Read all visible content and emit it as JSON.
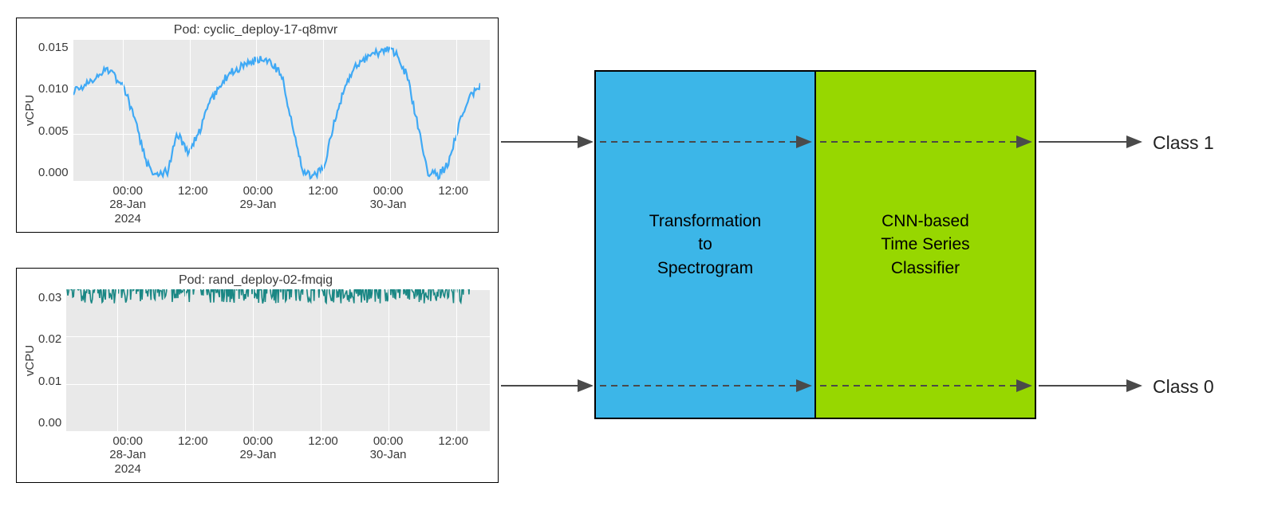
{
  "chart_data": [
    {
      "type": "line",
      "title": "Pod: cyclic_deploy-17-q8mvr",
      "ylabel": "vCPU",
      "xlabel": "",
      "ylim": [
        0.0,
        0.015
      ],
      "yticks": [
        "0.015",
        "0.010",
        "0.005",
        "0.000"
      ],
      "xticks": [
        {
          "pos": 0.12,
          "lines": [
            "00:00",
            "28-Jan",
            "2024"
          ]
        },
        {
          "pos": 0.28,
          "lines": [
            "12:00"
          ]
        },
        {
          "pos": 0.44,
          "lines": [
            "00:00",
            "29-Jan"
          ]
        },
        {
          "pos": 0.6,
          "lines": [
            "12:00"
          ]
        },
        {
          "pos": 0.76,
          "lines": [
            "00:00",
            "30-Jan"
          ]
        },
        {
          "pos": 0.92,
          "lines": [
            "12:00"
          ]
        }
      ],
      "series": [
        {
          "name": "vCPU",
          "color": "#3fa9f5",
          "x": [
            0,
            2,
            4,
            6,
            8,
            10,
            12,
            14,
            16,
            18,
            20,
            22,
            24,
            26,
            28,
            30,
            32,
            34,
            36,
            38,
            40,
            42,
            44,
            46,
            48,
            50,
            52,
            54,
            56,
            58,
            60,
            62,
            64,
            66,
            68,
            70,
            72
          ],
          "values": [
            0.0095,
            0.01,
            0.0105,
            0.012,
            0.011,
            0.0095,
            0.006,
            0.002,
            0.0005,
            0.001,
            0.005,
            0.003,
            0.005,
            0.008,
            0.01,
            0.0115,
            0.012,
            0.0125,
            0.013,
            0.0125,
            0.011,
            0.006,
            0.001,
            0.0005,
            0.0015,
            0.006,
            0.01,
            0.012,
            0.013,
            0.0135,
            0.014,
            0.0135,
            0.011,
            0.006,
            0.001,
            0.0005,
            0.002,
            0.006,
            0.009,
            0.01
          ]
        }
      ]
    },
    {
      "type": "line",
      "title": "Pod: rand_deploy-02-fmqig",
      "ylabel": "vCPU",
      "xlabel": "",
      "ylim": [
        0.0,
        0.03
      ],
      "yticks": [
        "0.03",
        "0.02",
        "0.01",
        "0.00"
      ],
      "xticks": [
        {
          "pos": 0.12,
          "lines": [
            "00:00",
            "28-Jan",
            "2024"
          ]
        },
        {
          "pos": 0.28,
          "lines": [
            "12:00"
          ]
        },
        {
          "pos": 0.44,
          "lines": [
            "00:00",
            "29-Jan"
          ]
        },
        {
          "pos": 0.6,
          "lines": [
            "12:00"
          ]
        },
        {
          "pos": 0.76,
          "lines": [
            "00:00",
            "30-Jan"
          ]
        },
        {
          "pos": 0.92,
          "lines": [
            "12:00"
          ]
        }
      ],
      "series": [
        {
          "name": "vCPU",
          "color": "#1a8784",
          "band_center": 0.03,
          "band_jitter": 0.003
        }
      ]
    }
  ],
  "pipeline": {
    "stage1": "Transformation\nto\nSpectrogram",
    "stage2": "CNN-based\nTime Series\nClassifier"
  },
  "outputs": {
    "class1": "Class 1",
    "class0": "Class 0"
  },
  "colors": {
    "blue_box": "#3cb6e8",
    "green_box": "#97d700",
    "arrow": "#4a4a4a"
  }
}
